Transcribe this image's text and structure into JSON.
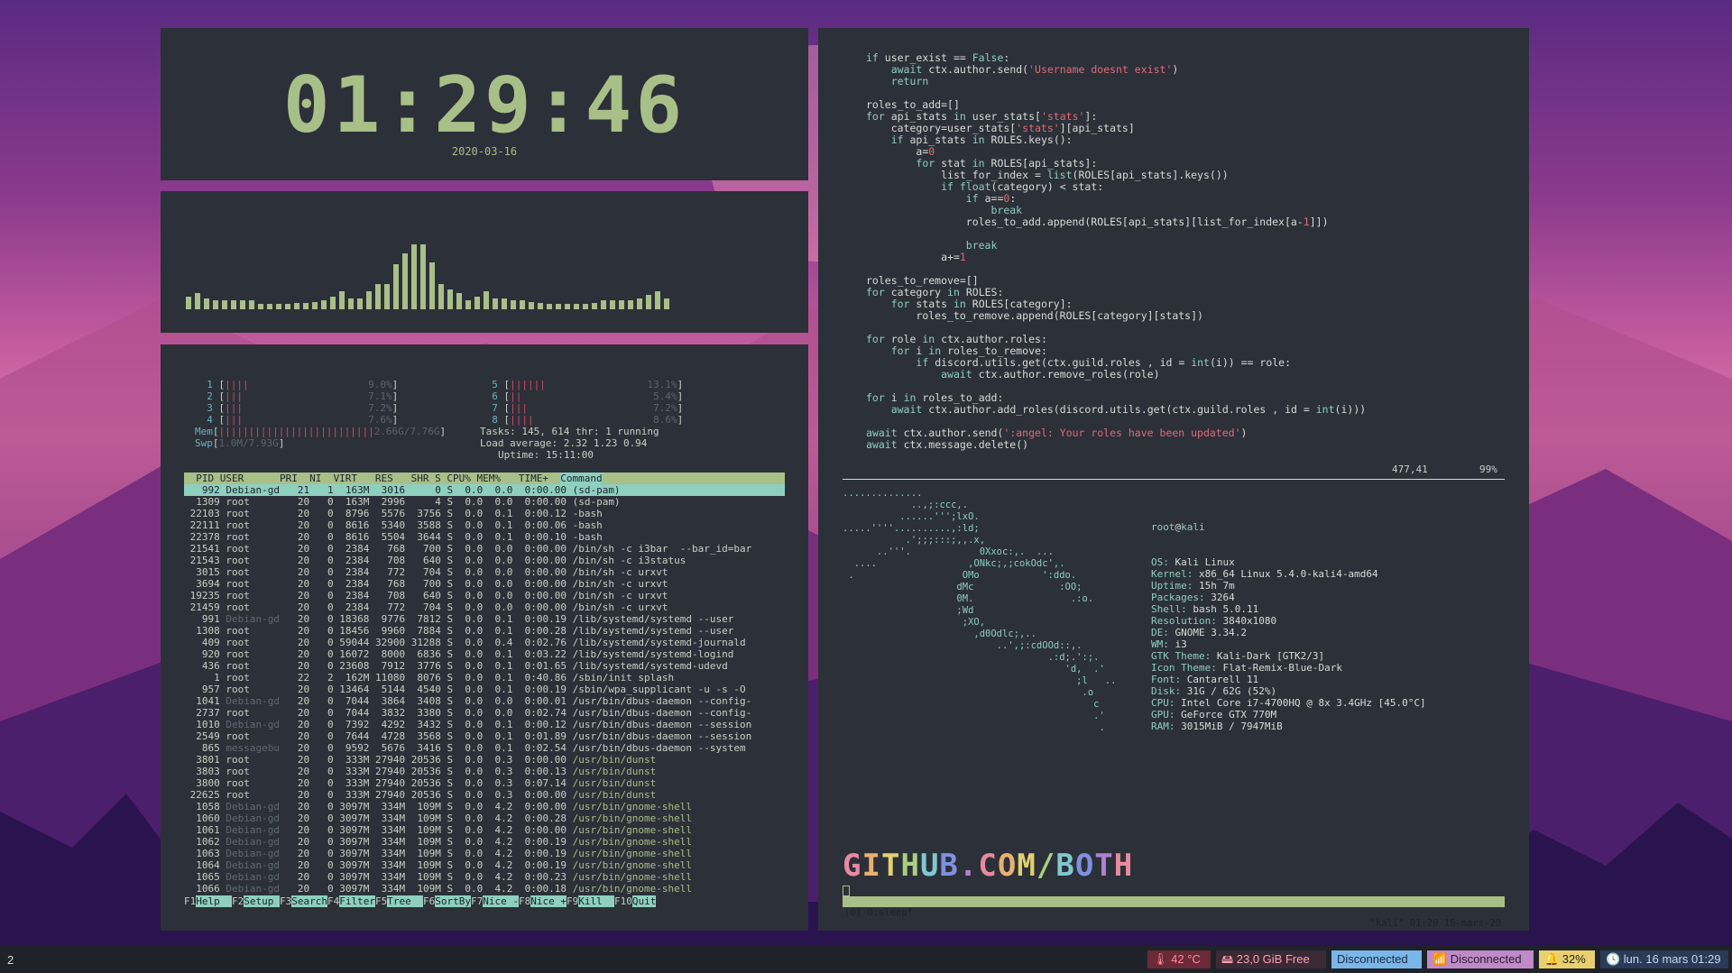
{
  "clock": {
    "time": "01:29:46",
    "date": "2020-03-16"
  },
  "visualizer": {
    "levels": [
      0.14,
      0.18,
      0.12,
      0.1,
      0.1,
      0.1,
      0.1,
      0.1,
      0.06,
      0.06,
      0.06,
      0.06,
      0.07,
      0.07,
      0.08,
      0.1,
      0.14,
      0.2,
      0.12,
      0.12,
      0.2,
      0.28,
      0.28,
      0.5,
      0.62,
      0.72,
      0.72,
      0.52,
      0.28,
      0.22,
      0.18,
      0.1,
      0.14,
      0.2,
      0.12,
      0.12,
      0.1,
      0.1,
      0.08,
      0.07,
      0.06,
      0.06,
      0.06,
      0.06,
      0.06,
      0.07,
      0.1,
      0.1,
      0.1,
      0.1,
      0.12,
      0.16,
      0.2,
      0.12
    ]
  },
  "htop": {
    "cpus": [
      {
        "n": "1",
        "bar": "||||",
        "pct": "9.0%"
      },
      {
        "n": "2",
        "bar": "|||",
        "pct": "7.1%"
      },
      {
        "n": "3",
        "bar": "|||",
        "pct": "7.2%"
      },
      {
        "n": "4",
        "bar": "|||",
        "pct": "7.6%"
      },
      {
        "n": "5",
        "bar": "||||||",
        "pct": "13.1%"
      },
      {
        "n": "6",
        "bar": "||",
        "pct": "5.4%"
      },
      {
        "n": "7",
        "bar": "|||",
        "pct": "7.2%"
      },
      {
        "n": "8",
        "bar": "||||",
        "pct": "8.6%"
      }
    ],
    "mem": {
      "label": "Mem",
      "bar": "||||||||||||||||||||||||||",
      "value": "2.66G/7.76G"
    },
    "swp": {
      "label": "Swp",
      "bar": "",
      "value": "1.0M/7.93G"
    },
    "tasks": "Tasks: 145, 614 thr: 1 running",
    "load": "Load average: 2.32 1.23 0.94",
    "uptime": "Uptime: 15:11:00",
    "header": "  PID USER      PRI  NI  VIRT   RES   SHR S CPU% MEM%   TIME+  ",
    "header_cmd": "Command",
    "rows": [
      {
        "pid": "992",
        "user": "Debian-gd",
        "pri": "21",
        "ni": "1",
        "virt": "163M",
        "res": "3016",
        "shr": "0",
        "s": "S",
        "cpu": "0.0",
        "mem": "0.0",
        "time": "0:00.00",
        "cmd": "(sd-pam)",
        "sel": true
      },
      {
        "pid": "1309",
        "user": "root",
        "pri": "20",
        "ni": "0",
        "virt": "163M",
        "res": "2996",
        "shr": "4",
        "s": "S",
        "cpu": "0.0",
        "mem": "0.0",
        "time": "0:00.00",
        "cmd": "(sd-pam)"
      },
      {
        "pid": "22103",
        "user": "root",
        "pri": "20",
        "ni": "0",
        "virt": "8796",
        "res": "5576",
        "shr": "3756",
        "s": "S",
        "cpu": "0.0",
        "mem": "0.1",
        "time": "0:00.12",
        "cmd": "-bash"
      },
      {
        "pid": "22111",
        "user": "root",
        "pri": "20",
        "ni": "0",
        "virt": "8616",
        "res": "5340",
        "shr": "3588",
        "s": "S",
        "cpu": "0.0",
        "mem": "0.1",
        "time": "0:00.06",
        "cmd": "-bash"
      },
      {
        "pid": "22378",
        "user": "root",
        "pri": "20",
        "ni": "0",
        "virt": "8616",
        "res": "5504",
        "shr": "3644",
        "s": "S",
        "cpu": "0.0",
        "mem": "0.1",
        "time": "0:00.10",
        "cmd": "-bash"
      },
      {
        "pid": "21541",
        "user": "root",
        "pri": "20",
        "ni": "0",
        "virt": "2384",
        "res": "768",
        "shr": "700",
        "s": "S",
        "cpu": "0.0",
        "mem": "0.0",
        "time": "0:00.00",
        "cmd": "/bin/sh -c i3bar  --bar_id=bar"
      },
      {
        "pid": "21543",
        "user": "root",
        "pri": "20",
        "ni": "0",
        "virt": "2384",
        "res": "708",
        "shr": "640",
        "s": "S",
        "cpu": "0.0",
        "mem": "0.0",
        "time": "0:00.00",
        "cmd": "/bin/sh -c i3status"
      },
      {
        "pid": "3015",
        "user": "root",
        "pri": "20",
        "ni": "0",
        "virt": "2384",
        "res": "772",
        "shr": "704",
        "s": "S",
        "cpu": "0.0",
        "mem": "0.0",
        "time": "0:00.00",
        "cmd": "/bin/sh -c urxvt"
      },
      {
        "pid": "3694",
        "user": "root",
        "pri": "20",
        "ni": "0",
        "virt": "2384",
        "res": "768",
        "shr": "700",
        "s": "S",
        "cpu": "0.0",
        "mem": "0.0",
        "time": "0:00.00",
        "cmd": "/bin/sh -c urxvt"
      },
      {
        "pid": "19235",
        "user": "root",
        "pri": "20",
        "ni": "0",
        "virt": "2384",
        "res": "708",
        "shr": "640",
        "s": "S",
        "cpu": "0.0",
        "mem": "0.0",
        "time": "0:00.00",
        "cmd": "/bin/sh -c urxvt"
      },
      {
        "pid": "21459",
        "user": "root",
        "pri": "20",
        "ni": "0",
        "virt": "2384",
        "res": "772",
        "shr": "704",
        "s": "S",
        "cpu": "0.0",
        "mem": "0.0",
        "time": "0:00.00",
        "cmd": "/bin/sh -c urxvt"
      },
      {
        "pid": "991",
        "user": "Debian-gd",
        "pri": "20",
        "ni": "0",
        "virt": "18368",
        "res": "9776",
        "shr": "7812",
        "s": "S",
        "cpu": "0.0",
        "mem": "0.1",
        "time": "0:00.19",
        "cmd": "/lib/systemd/systemd --user"
      },
      {
        "pid": "1308",
        "user": "root",
        "pri": "20",
        "ni": "0",
        "virt": "18456",
        "res": "9960",
        "shr": "7884",
        "s": "S",
        "cpu": "0.0",
        "mem": "0.1",
        "time": "0:00.28",
        "cmd": "/lib/systemd/systemd --user"
      },
      {
        "pid": "409",
        "user": "root",
        "pri": "20",
        "ni": "0",
        "virt": "59044",
        "res": "32900",
        "shr": "31288",
        "s": "S",
        "cpu": "0.0",
        "mem": "0.4",
        "time": "0:02.76",
        "cmd": "/lib/systemd/systemd-journald"
      },
      {
        "pid": "920",
        "user": "root",
        "pri": "20",
        "ni": "0",
        "virt": "16072",
        "res": "8000",
        "shr": "6836",
        "s": "S",
        "cpu": "0.0",
        "mem": "0.1",
        "time": "0:03.22",
        "cmd": "/lib/systemd/systemd-logind"
      },
      {
        "pid": "436",
        "user": "root",
        "pri": "20",
        "ni": "0",
        "virt": "23608",
        "res": "7912",
        "shr": "3776",
        "s": "S",
        "cpu": "0.0",
        "mem": "0.1",
        "time": "0:01.65",
        "cmd": "/lib/systemd/systemd-udevd"
      },
      {
        "pid": "1",
        "user": "root",
        "pri": "22",
        "ni": "2",
        "virt": "162M",
        "res": "11080",
        "shr": "8076",
        "s": "S",
        "cpu": "0.0",
        "mem": "0.1",
        "time": "0:40.86",
        "cmd": "/sbin/init splash"
      },
      {
        "pid": "957",
        "user": "root",
        "pri": "20",
        "ni": "0",
        "virt": "13464",
        "res": "5144",
        "shr": "4540",
        "s": "S",
        "cpu": "0.0",
        "mem": "0.1",
        "time": "0:00.19",
        "cmd": "/sbin/wpa_supplicant -u -s -O"
      },
      {
        "pid": "1041",
        "user": "Debian-gd",
        "pri": "20",
        "ni": "0",
        "virt": "7044",
        "res": "3864",
        "shr": "3408",
        "s": "S",
        "cpu": "0.0",
        "mem": "0.0",
        "time": "0:00.01",
        "cmd": "/usr/bin/dbus-daemon --config-"
      },
      {
        "pid": "2737",
        "user": "root",
        "pri": "20",
        "ni": "0",
        "virt": "7044",
        "res": "3832",
        "shr": "3380",
        "s": "S",
        "cpu": "0.0",
        "mem": "0.0",
        "time": "0:02.74",
        "cmd": "/usr/bin/dbus-daemon --config-"
      },
      {
        "pid": "1010",
        "user": "Debian-gd",
        "pri": "20",
        "ni": "0",
        "virt": "7392",
        "res": "4292",
        "shr": "3432",
        "s": "S",
        "cpu": "0.0",
        "mem": "0.1",
        "time": "0:00.12",
        "cmd": "/usr/bin/dbus-daemon --session"
      },
      {
        "pid": "2549",
        "user": "root",
        "pri": "20",
        "ni": "0",
        "virt": "7644",
        "res": "4728",
        "shr": "3568",
        "s": "S",
        "cpu": "0.0",
        "mem": "0.1",
        "time": "0:01.89",
        "cmd": "/usr/bin/dbus-daemon --session"
      },
      {
        "pid": "865",
        "user": "messagebu",
        "pri": "20",
        "ni": "0",
        "virt": "9592",
        "res": "5676",
        "shr": "3416",
        "s": "S",
        "cpu": "0.0",
        "mem": "0.1",
        "time": "0:02.54",
        "cmd": "/usr/bin/dbus-daemon --system"
      },
      {
        "pid": "3801",
        "user": "root",
        "pri": "20",
        "ni": "0",
        "virt": "333M",
        "res": "27940",
        "shr": "20536",
        "s": "S",
        "cpu": "0.0",
        "mem": "0.3",
        "time": "0:00.00",
        "cmd": "/usr/bin/dunst"
      },
      {
        "pid": "3803",
        "user": "root",
        "pri": "20",
        "ni": "0",
        "virt": "333M",
        "res": "27940",
        "shr": "20536",
        "s": "S",
        "cpu": "0.0",
        "mem": "0.3",
        "time": "0:00.13",
        "cmd": "/usr/bin/dunst"
      },
      {
        "pid": "3800",
        "user": "root",
        "pri": "20",
        "ni": "0",
        "virt": "333M",
        "res": "27940",
        "shr": "20536",
        "s": "S",
        "cpu": "0.0",
        "mem": "0.3",
        "time": "0:07.14",
        "cmd": "/usr/bin/dunst"
      },
      {
        "pid": "22625",
        "user": "root",
        "pri": "20",
        "ni": "0",
        "virt": "333M",
        "res": "27940",
        "shr": "20536",
        "s": "S",
        "cpu": "0.0",
        "mem": "0.3",
        "time": "0:00.00",
        "cmd": "/usr/bin/dunst"
      },
      {
        "pid": "1058",
        "user": "Debian-gd",
        "pri": "20",
        "ni": "0",
        "virt": "3097M",
        "res": "334M",
        "shr": "109M",
        "s": "S",
        "cpu": "0.0",
        "mem": "4.2",
        "time": "0:00.00",
        "cmd": "/usr/bin/gnome-shell"
      },
      {
        "pid": "1060",
        "user": "Debian-gd",
        "pri": "20",
        "ni": "0",
        "virt": "3097M",
        "res": "334M",
        "shr": "109M",
        "s": "S",
        "cpu": "0.0",
        "mem": "4.2",
        "time": "0:00.28",
        "cmd": "/usr/bin/gnome-shell"
      },
      {
        "pid": "1061",
        "user": "Debian-gd",
        "pri": "20",
        "ni": "0",
        "virt": "3097M",
        "res": "334M",
        "shr": "109M",
        "s": "S",
        "cpu": "0.0",
        "mem": "4.2",
        "time": "0:00.00",
        "cmd": "/usr/bin/gnome-shell"
      },
      {
        "pid": "1062",
        "user": "Debian-gd",
        "pri": "20",
        "ni": "0",
        "virt": "3097M",
        "res": "334M",
        "shr": "109M",
        "s": "S",
        "cpu": "0.0",
        "mem": "4.2",
        "time": "0:00.19",
        "cmd": "/usr/bin/gnome-shell"
      },
      {
        "pid": "1063",
        "user": "Debian-gd",
        "pri": "20",
        "ni": "0",
        "virt": "3097M",
        "res": "334M",
        "shr": "109M",
        "s": "S",
        "cpu": "0.0",
        "mem": "4.2",
        "time": "0:00.19",
        "cmd": "/usr/bin/gnome-shell"
      },
      {
        "pid": "1064",
        "user": "Debian-gd",
        "pri": "20",
        "ni": "0",
        "virt": "3097M",
        "res": "334M",
        "shr": "109M",
        "s": "S",
        "cpu": "0.0",
        "mem": "4.2",
        "time": "0:00.19",
        "cmd": "/usr/bin/gnome-shell"
      },
      {
        "pid": "1065",
        "user": "Debian-gd",
        "pri": "20",
        "ni": "0",
        "virt": "3097M",
        "res": "334M",
        "shr": "109M",
        "s": "S",
        "cpu": "0.0",
        "mem": "4.2",
        "time": "0:00.23",
        "cmd": "/usr/bin/gnome-shell"
      },
      {
        "pid": "1066",
        "user": "Debian-gd",
        "pri": "20",
        "ni": "0",
        "virt": "3097M",
        "res": "334M",
        "shr": "109M",
        "s": "S",
        "cpu": "0.0",
        "mem": "4.2",
        "time": "0:00.18",
        "cmd": "/usr/bin/gnome-shell"
      }
    ],
    "fkeys": [
      {
        "k": "F1",
        "v": "Help  "
      },
      {
        "k": "F2",
        "v": "Setup "
      },
      {
        "k": "F3",
        "v": "Search"
      },
      {
        "k": "F4",
        "v": "Filter"
      },
      {
        "k": "F5",
        "v": "Tree  "
      },
      {
        "k": "F6",
        "v": "SortBy"
      },
      {
        "k": "F7",
        "v": "Nice -"
      },
      {
        "k": "F8",
        "v": "Nice +"
      },
      {
        "k": "F9",
        "v": "Kill  "
      },
      {
        "k": "F10",
        "v": "Quit"
      }
    ]
  },
  "editor": {
    "lines": [
      "if user_exist == False:",
      "    await ctx.author.send('Username doesnt exist')",
      "    return",
      "",
      "roles_to_add=[]",
      "for api_stats in user_stats['stats']:",
      "    category=user_stats['stats'][api_stats]",
      "    if api_stats in ROLES.keys():",
      "        a=0",
      "        for stat in ROLES[api_stats]:",
      "            list_for_index = list(ROLES[api_stats].keys())",
      "            if float(category) < stat:",
      "                if a==0:",
      "                    break",
      "                roles_to_add.append(ROLES[api_stats][list_for_index[a-1]])",
      "",
      "                break",
      "            a+=1",
      "",
      "roles_to_remove=[]",
      "for category in ROLES:",
      "    for stats in ROLES[category]:",
      "        roles_to_remove.append(ROLES[category][stats])",
      "",
      "for role in ctx.author.roles:",
      "    for i in roles_to_remove:",
      "        if discord.utils.get(ctx.guild.roles , id = int(i)) == role:",
      "            await ctx.author.remove_roles(role)",
      "",
      "for i in roles_to_add:",
      "    await ctx.author.add_roles(discord.utils.get(ctx.guild.roles , id = int(i)))",
      "",
      "await ctx.author.send(':angel: Your roles have been updated')",
      "await ctx.message.delete()"
    ],
    "position": "477,41",
    "percent": "99%"
  },
  "neofetch": {
    "ascii": [
      "..............",
      "            ..,;:ccc,.",
      "          ......''';lxO.",
      ".....''''..........,:ld;",
      "           .';;;:::;,,.x,",
      "      ..'''.            0Xxoc:,.  ...",
      "  ....                ,ONkc;,;cokOdc',.",
      " .                   OMo           ':ddo.",
      "                    dMc               :OO;",
      "                    0M.                 .:o.",
      "                    ;Wd",
      "                     ;XO,",
      "                       ,d0Odlc;,..",
      "                           ..',;:cdOOd::,.",
      "                                    .:d;.':;.",
      "                                       'd,  .'",
      "                                         ;l   ..",
      "                                          .o",
      "                                            c",
      "                                            .'",
      "                                             ."
    ],
    "user": "root",
    "host": "kali",
    "info": [
      {
        "k": "OS",
        "v": "Kali Linux"
      },
      {
        "k": "Kernel",
        "v": "x86_64 Linux 5.4.0-kali4-amd64"
      },
      {
        "k": "Uptime",
        "v": "15h 7m"
      },
      {
        "k": "Packages",
        "v": "3264"
      },
      {
        "k": "Shell",
        "v": "bash 5.0.11"
      },
      {
        "k": "Resolution",
        "v": "3840x1080"
      },
      {
        "k": "DE",
        "v": "GNOME 3.34.2"
      },
      {
        "k": "WM",
        "v": "i3"
      },
      {
        "k": "GTK Theme",
        "v": "Kali-Dark [GTK2/3]"
      },
      {
        "k": "Icon Theme",
        "v": "Flat-Remix-Blue-Dark"
      },
      {
        "k": "Font",
        "v": "Cantarell 11"
      },
      {
        "k": "Disk",
        "v": "31G / 62G (52%)"
      },
      {
        "k": "CPU",
        "v": "Intel Core i7-4700HQ @ 8x 3.4GHz [45.0°C]"
      },
      {
        "k": "GPU",
        "v": "GeForce GTX 770M"
      },
      {
        "k": "RAM",
        "v": "3015MiB / 7947MiB"
      }
    ],
    "banner": "GITHUB.COM/BOTH",
    "banner_colors": [
      "#e88aa0",
      "#e8b070",
      "#e0d070",
      "#a8d080",
      "#80c8d0",
      "#8090e0",
      "#b080d0",
      "#e88aa0",
      "#e8b070",
      "#e0d070",
      "#a8d080",
      "#80c8d0",
      "#8090e0",
      "#b080d0",
      "#e88aa0"
    ],
    "tmux_left": "[0] 0:sleep*",
    "tmux_right": "\"kali\" 01:29 16-mars-20"
  },
  "bar": {
    "workspace": "2",
    "segments": [
      {
        "text": "🌡 42 °C",
        "fg": "#ff8a9a",
        "bg": "#6a2a38"
      },
      {
        "text": "🖴 23,0 GiB Free",
        "fg": "#ff9fb0",
        "bg": "#3a2a34"
      },
      {
        "text": "Disconnected",
        "fg": "#1c2a40",
        "bg": "#7ab6e8"
      },
      {
        "text": "📶 Disconnected",
        "fg": "#2a1c30",
        "bg": "#c08ac8"
      },
      {
        "text": "🔔 32%",
        "fg": "#2a2410",
        "bg": "#e8d070"
      },
      {
        "text": "🕓 lun. 16 mars 01:29",
        "fg": "#c8d8f0",
        "bg": "#2a3a58"
      }
    ]
  },
  "colors": {
    "panel": "#2c3038",
    "accent_green": "#a8bf88",
    "accent_cyan": "#8ecfc0",
    "accent_red": "#e06a7a"
  }
}
